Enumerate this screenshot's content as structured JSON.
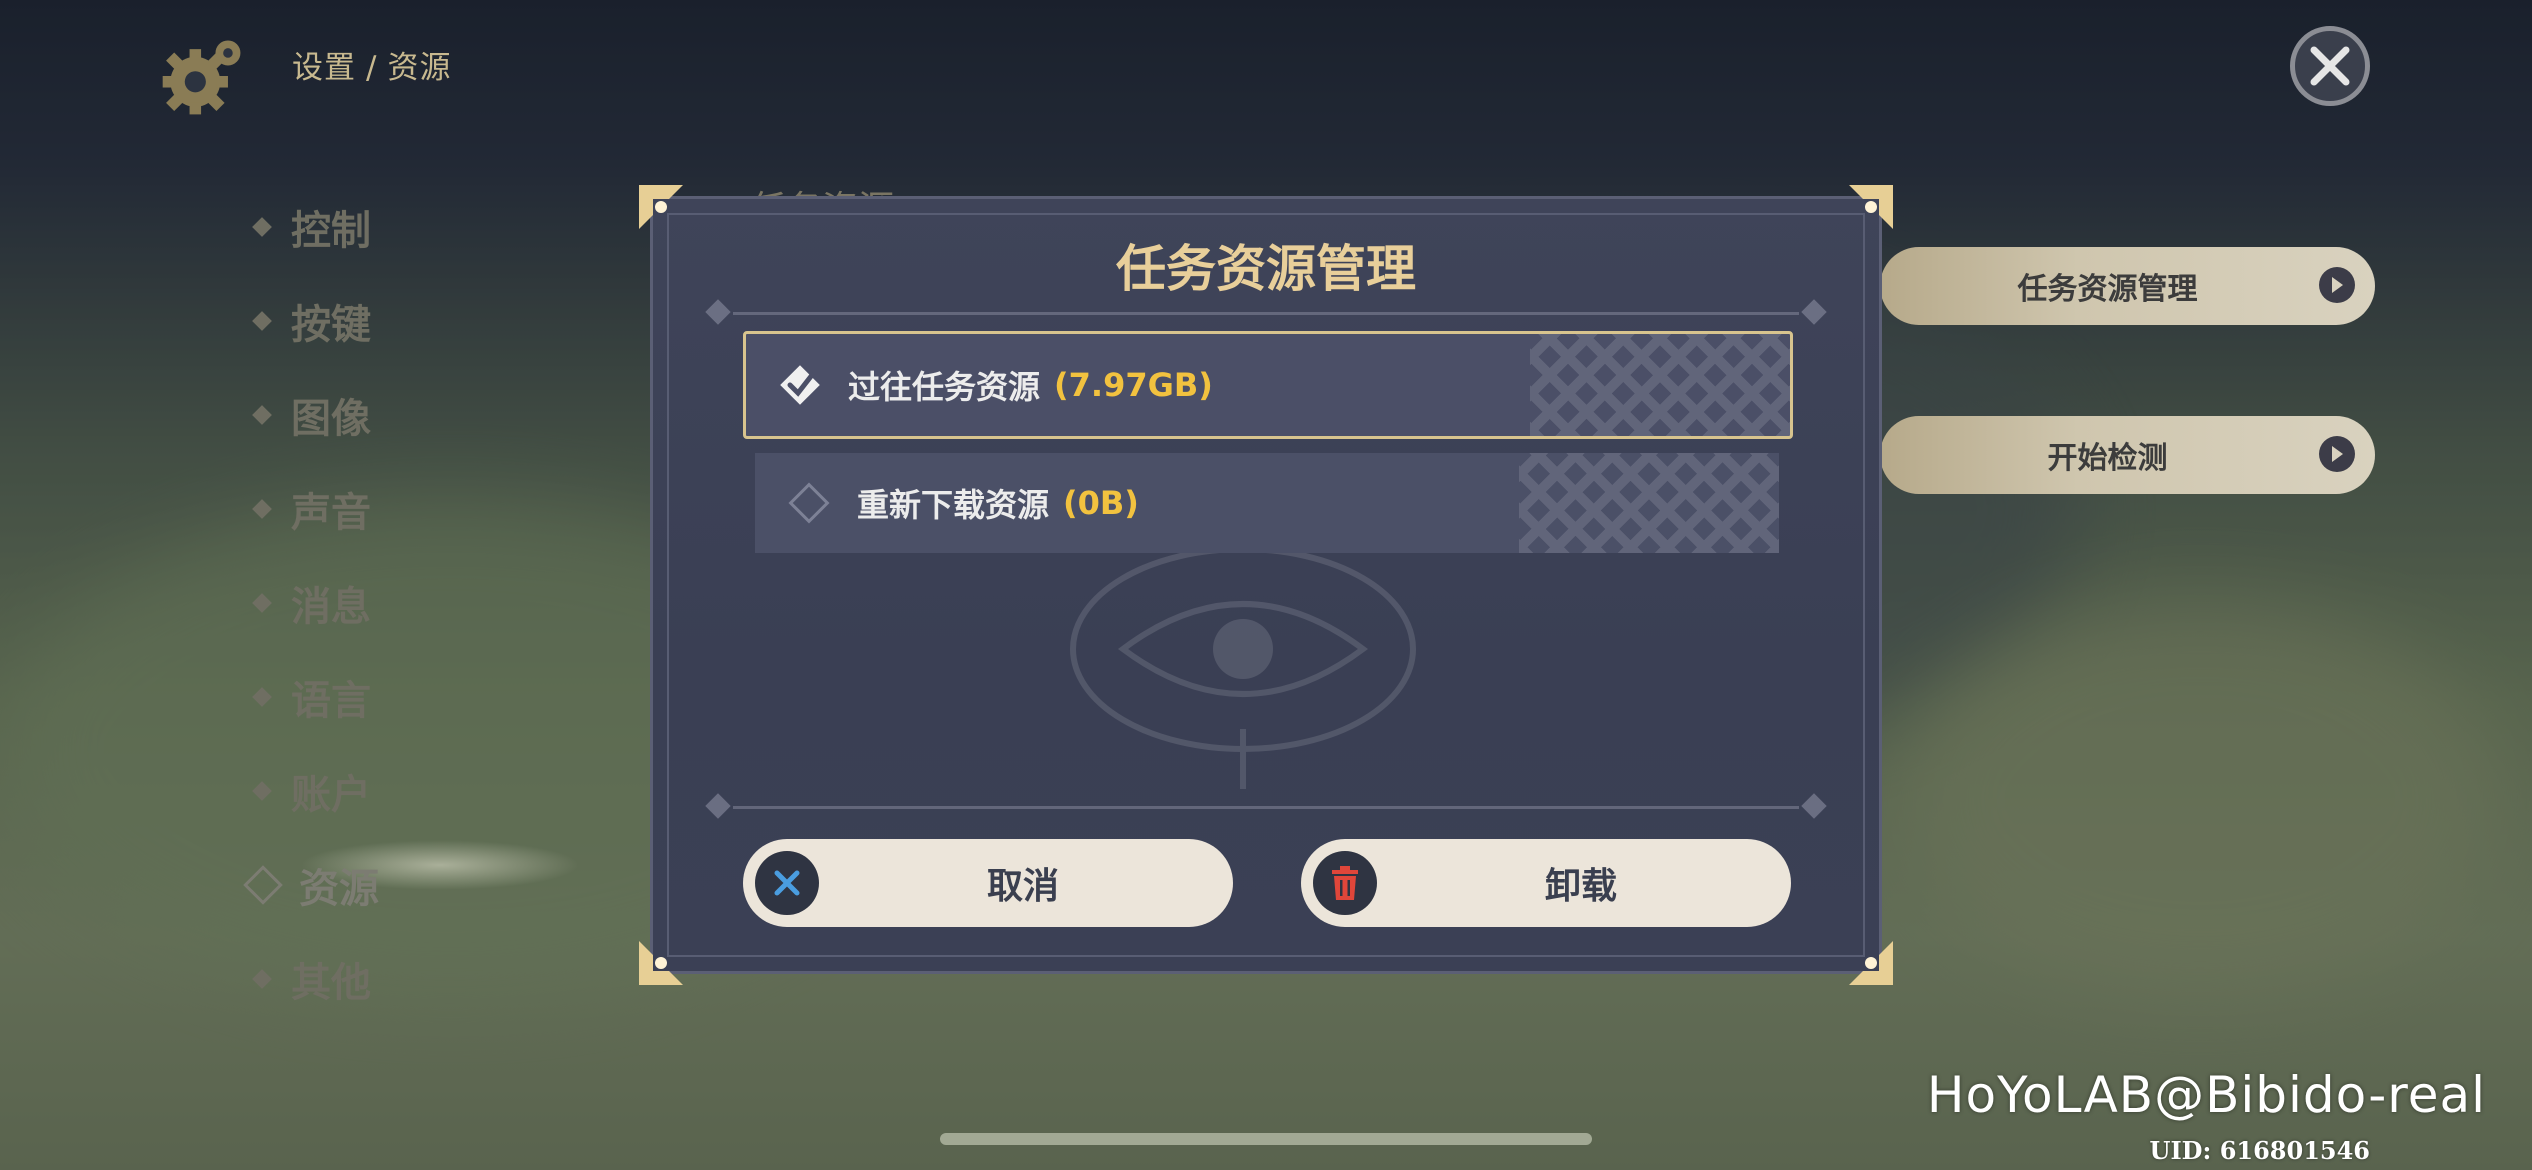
{
  "breadcrumb": {
    "parent": "设置",
    "separator": "/",
    "current": "资源"
  },
  "sidebar": {
    "items": [
      {
        "label": "控制"
      },
      {
        "label": "按键"
      },
      {
        "label": "图像"
      },
      {
        "label": "声音"
      },
      {
        "label": "消息"
      },
      {
        "label": "语言"
      },
      {
        "label": "账户"
      },
      {
        "label": "资源",
        "active": true
      },
      {
        "label": "其他"
      }
    ]
  },
  "background": {
    "section_title": "任务资源",
    "buttons": [
      {
        "label": "任务资源管理"
      },
      {
        "label": "开始检测"
      }
    ]
  },
  "dialog": {
    "title": "任务资源管理",
    "options": [
      {
        "label": "过往任务资源",
        "size": "(7.97GB)",
        "checked": true
      },
      {
        "label": "重新下载资源",
        "size": "(0B)",
        "checked": false
      }
    ],
    "cancel_label": "取消",
    "uninstall_label": "卸载"
  },
  "icons": {
    "settings": "gear-icon",
    "close": "close-icon",
    "cancel": "x-icon",
    "uninstall": "trash-icon",
    "go": "arrow-right-icon"
  },
  "colors": {
    "dialog_bg": "#3f4459",
    "title_gold": "#e8cf9a",
    "size_yellow": "#f2c23f",
    "button_bg": "#ece5da",
    "trash_red": "#e0463a",
    "x_blue": "#4a9de0"
  },
  "watermark": {
    "handle": "HoYoLAB@Bibido-real",
    "uid": "UID: 616801546"
  }
}
